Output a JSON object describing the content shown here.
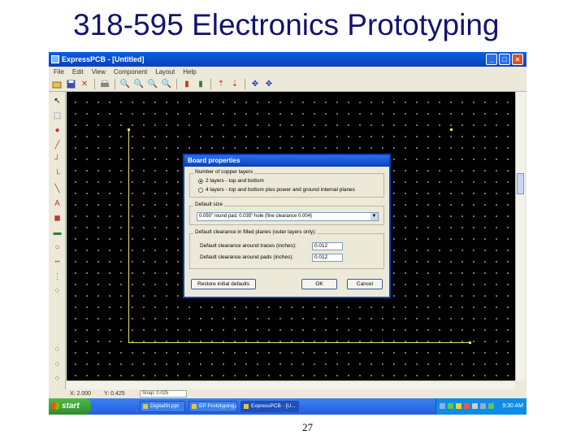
{
  "slide": {
    "title": "318-595 Electronics Prototyping",
    "page_number": "27"
  },
  "window": {
    "title": "ExpressPCB - [Untitled]",
    "minimize": "_",
    "maximize": "□",
    "close": "×"
  },
  "menu": [
    "File",
    "Edit",
    "View",
    "Component",
    "Layout",
    "Help"
  ],
  "dialog": {
    "title": "Board properties",
    "layers_group": "Number of copper layers",
    "layer_options": [
      {
        "label": "2 layers - top and bottom",
        "selected": true
      },
      {
        "label": "4 layers - top and bottom plus power and ground internal planes",
        "selected": false
      }
    ],
    "default_size_group": "Default size",
    "default_size_value": "0.050\" round pad, 0.035\" hole (fine clearance 0.004)",
    "clearance_group": "Default clearance in filled planes (outer layers only):",
    "traces_label": "Default clearance around traces (inches):",
    "traces_value": "0.012",
    "pads_label": "Default clearance around pads (inches):",
    "pads_value": "0.012",
    "defaults_button": "Restore initial defaults",
    "ok_button": "OK",
    "cancel_button": "Cancel"
  },
  "statusbar": {
    "x": "X: 2.000",
    "y": "Y: 0.425",
    "snap": "Snap: 0.025"
  },
  "taskbar": {
    "start": "start",
    "tasks": [
      {
        "label": "DigitalSt.ppt",
        "active": false
      },
      {
        "label": "EP Prototyping.ppt",
        "active": false
      },
      {
        "label": "ExpressPCB - [U...",
        "active": true
      }
    ],
    "clock": "9:30 AM"
  },
  "colors": {
    "title_blue": "#13136e",
    "canvas": "#000000",
    "board_outline": "#e7e75c",
    "xp_blue": "#245edb",
    "start_green": "#2f8a2c"
  },
  "icons": {
    "toolbar": [
      "open-icon",
      "save-icon",
      "delete-icon",
      "print-icon",
      "zoom-in-icon",
      "zoom-out-icon",
      "zoom-fit-icon",
      "zoom-board-icon",
      "layer-top-icon",
      "layer-bottom-icon",
      "move-up-icon",
      "move-down-icon",
      "pan-icon",
      "center-icon"
    ],
    "left": [
      "pointer-icon",
      "select-icon",
      "pad-icon",
      "trace-icon",
      "trace-bend-icon",
      "trace-angle-icon",
      "diagonal-icon",
      "arc-icon",
      "text-icon",
      "component-icon",
      "filled-plane-icon",
      "circle-icon",
      "line-icon",
      "ratsnest-icon",
      "net-icon"
    ]
  }
}
